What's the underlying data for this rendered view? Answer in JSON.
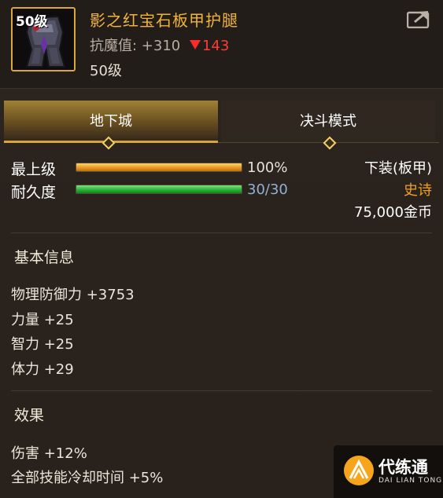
{
  "item": {
    "icon": "plate-greaves-icon",
    "level_badge": "50级",
    "name": "影之红宝石板甲护腿",
    "stat_label": "抗魔值: +310",
    "stat_delta": "143",
    "level_text": "50级"
  },
  "tabs": [
    {
      "label": "地下城",
      "active": true
    },
    {
      "label": "决斗模式",
      "active": false
    }
  ],
  "bars": {
    "level": {
      "label": "最上级",
      "value": "100%",
      "fraction": 1.0
    },
    "durability": {
      "label": "耐久度",
      "value": "30/30",
      "fraction": 1.0
    }
  },
  "meta": {
    "slot": "下装(板甲)",
    "rarity": "史诗",
    "price": "75,000金币"
  },
  "basic_info": {
    "title": "基本信息",
    "lines": [
      "物理防御力 +3753",
      "力量 +25",
      "智力 +25",
      "体力 +29"
    ]
  },
  "effects": {
    "title": "效果",
    "lines": [
      "伤害 +12%",
      "全部技能冷却时间 +5%"
    ]
  },
  "watermark": {
    "title": "代练通",
    "subtitle": "DAI LIAN TONG"
  },
  "colors": {
    "item_name": "#f0b43a",
    "rarity_epic": "#f29f28",
    "delta_red": "#ff3a3a",
    "tab_highlight": "#d8a43c"
  }
}
